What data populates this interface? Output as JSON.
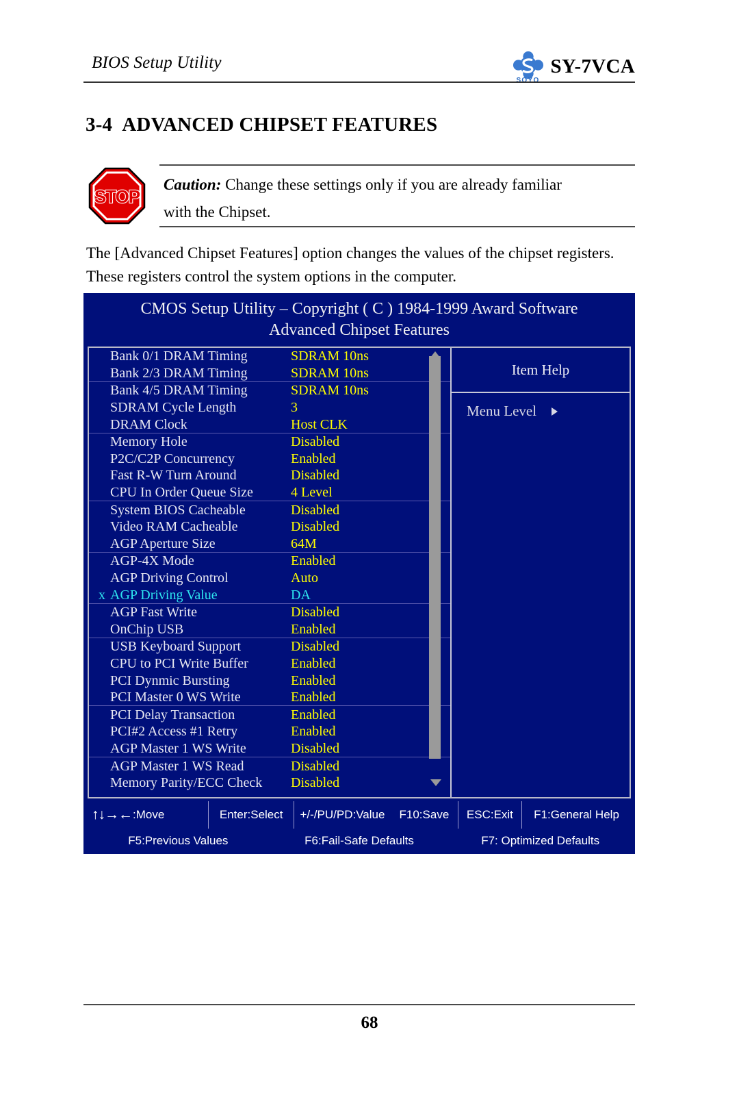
{
  "header": {
    "left_title": "BIOS Setup Utility",
    "logo_word": "SOYO",
    "model": "SY-7VCA"
  },
  "section": {
    "number": "3-4",
    "title": "ADVANCED CHIPSET FEATURES"
  },
  "caution": {
    "icon_label": "STOP",
    "label": "Caution:",
    "line1": "Change these settings only if you are already familiar",
    "line2": "with the Chipset."
  },
  "intro": "The [Advanced Chipset Features] option changes the values of the chipset registers. These registers control the system options in the computer.",
  "bios": {
    "title_line1": "CMOS Setup Utility – Copyright ( C ) 1984-1999 Award Software",
    "title_line2": "Advanced Chipset Features",
    "settings": [
      {
        "mark": "",
        "label": "Bank 0/1 DRAM Timing",
        "value": "SDRAM 10ns",
        "sep": false,
        "dim": false
      },
      {
        "mark": "",
        "label": "Bank 2/3 DRAM Timing",
        "value": "SDRAM 10ns",
        "sep": false,
        "dim": false
      },
      {
        "mark": "",
        "label": "Bank 4/5 DRAM Timing",
        "value": "SDRAM 10ns",
        "sep": true,
        "dim": false
      },
      {
        "mark": "",
        "label": "SDRAM Cycle Length",
        "value": "3",
        "sep": false,
        "dim": false
      },
      {
        "mark": "",
        "label": "DRAM Clock",
        "value": "Host CLK",
        "sep": false,
        "dim": false
      },
      {
        "mark": "",
        "label": "Memory Hole",
        "value": "Disabled",
        "sep": true,
        "dim": false
      },
      {
        "mark": "",
        "label": "P2C/C2P Concurrency",
        "value": "Enabled",
        "sep": false,
        "dim": false
      },
      {
        "mark": "",
        "label": "Fast R-W Turn Around",
        "value": "Disabled",
        "sep": false,
        "dim": false
      },
      {
        "mark": "",
        "label": "CPU In Order Queue Size",
        "value": "4 Level",
        "sep": false,
        "dim": false
      },
      {
        "mark": "",
        "label": "System BIOS Cacheable",
        "value": "Disabled",
        "sep": true,
        "dim": false
      },
      {
        "mark": "",
        "label": "Video RAM Cacheable",
        "value": "Disabled",
        "sep": false,
        "dim": false
      },
      {
        "mark": "",
        "label": "AGP Aperture Size",
        "value": "64M",
        "sep": false,
        "dim": false
      },
      {
        "mark": "",
        "label": "AGP-4X Mode",
        "value": "Enabled",
        "sep": true,
        "dim": false
      },
      {
        "mark": "",
        "label": "AGP Driving Control",
        "value": "Auto",
        "sep": false,
        "dim": false
      },
      {
        "mark": "x",
        "label": "AGP Driving Value",
        "value": "DA",
        "sep": false,
        "dim": true
      },
      {
        "mark": "",
        "label": "AGP Fast Write",
        "value": "Disabled",
        "sep": true,
        "dim": false
      },
      {
        "mark": "",
        "label": "OnChip USB",
        "value": "Enabled",
        "sep": false,
        "dim": false
      },
      {
        "mark": "",
        "label": "USB Keyboard Support",
        "value": "Disabled",
        "sep": true,
        "dim": false
      },
      {
        "mark": "",
        "label": "CPU to PCI Write Buffer",
        "value": "Enabled",
        "sep": false,
        "dim": false
      },
      {
        "mark": "",
        "label": "PCI Dynmic Bursting",
        "value": "Enabled",
        "sep": false,
        "dim": false
      },
      {
        "mark": "",
        "label": "PCI Master 0 WS Write",
        "value": "Enabled",
        "sep": false,
        "dim": false
      },
      {
        "mark": "",
        "label": "PCI Delay Transaction",
        "value": "Enabled",
        "sep": true,
        "dim": false
      },
      {
        "mark": "",
        "label": "PCI#2 Access #1 Retry",
        "value": "Enabled",
        "sep": false,
        "dim": false
      },
      {
        "mark": "",
        "label": "AGP Master 1 WS Write",
        "value": "Disabled",
        "sep": false,
        "dim": false
      },
      {
        "mark": "",
        "label": "AGP Master 1 WS Read",
        "value": "Disabled",
        "sep": true,
        "dim": false
      },
      {
        "mark": "",
        "label": "Memory Parity/ECC Check",
        "value": "Disabled",
        "sep": false,
        "dim": false
      }
    ],
    "help": {
      "title": "Item Help",
      "menu_level_label": "Menu Level"
    },
    "keys_row1": [
      "↑↓→←:Move",
      "Enter:Select",
      "+/-/PU/PD:Value",
      "F10:Save",
      "ESC:Exit",
      "F1:General Help"
    ],
    "keys_row1_arrows": "↑↓→←",
    "keys_row1_move": ":Move",
    "keys_row2": [
      "F5:Previous Values",
      "F6:Fail-Safe Defaults",
      "F7: Optimized Defaults"
    ]
  },
  "footer": {
    "page_number": "68"
  },
  "colors": {
    "bios_background": "#000f7a",
    "bios_value": "#ffff00",
    "bios_disabled": "#2ee6f0",
    "brand_blue": "#2b6cc4",
    "stop_red": "#e00000"
  }
}
